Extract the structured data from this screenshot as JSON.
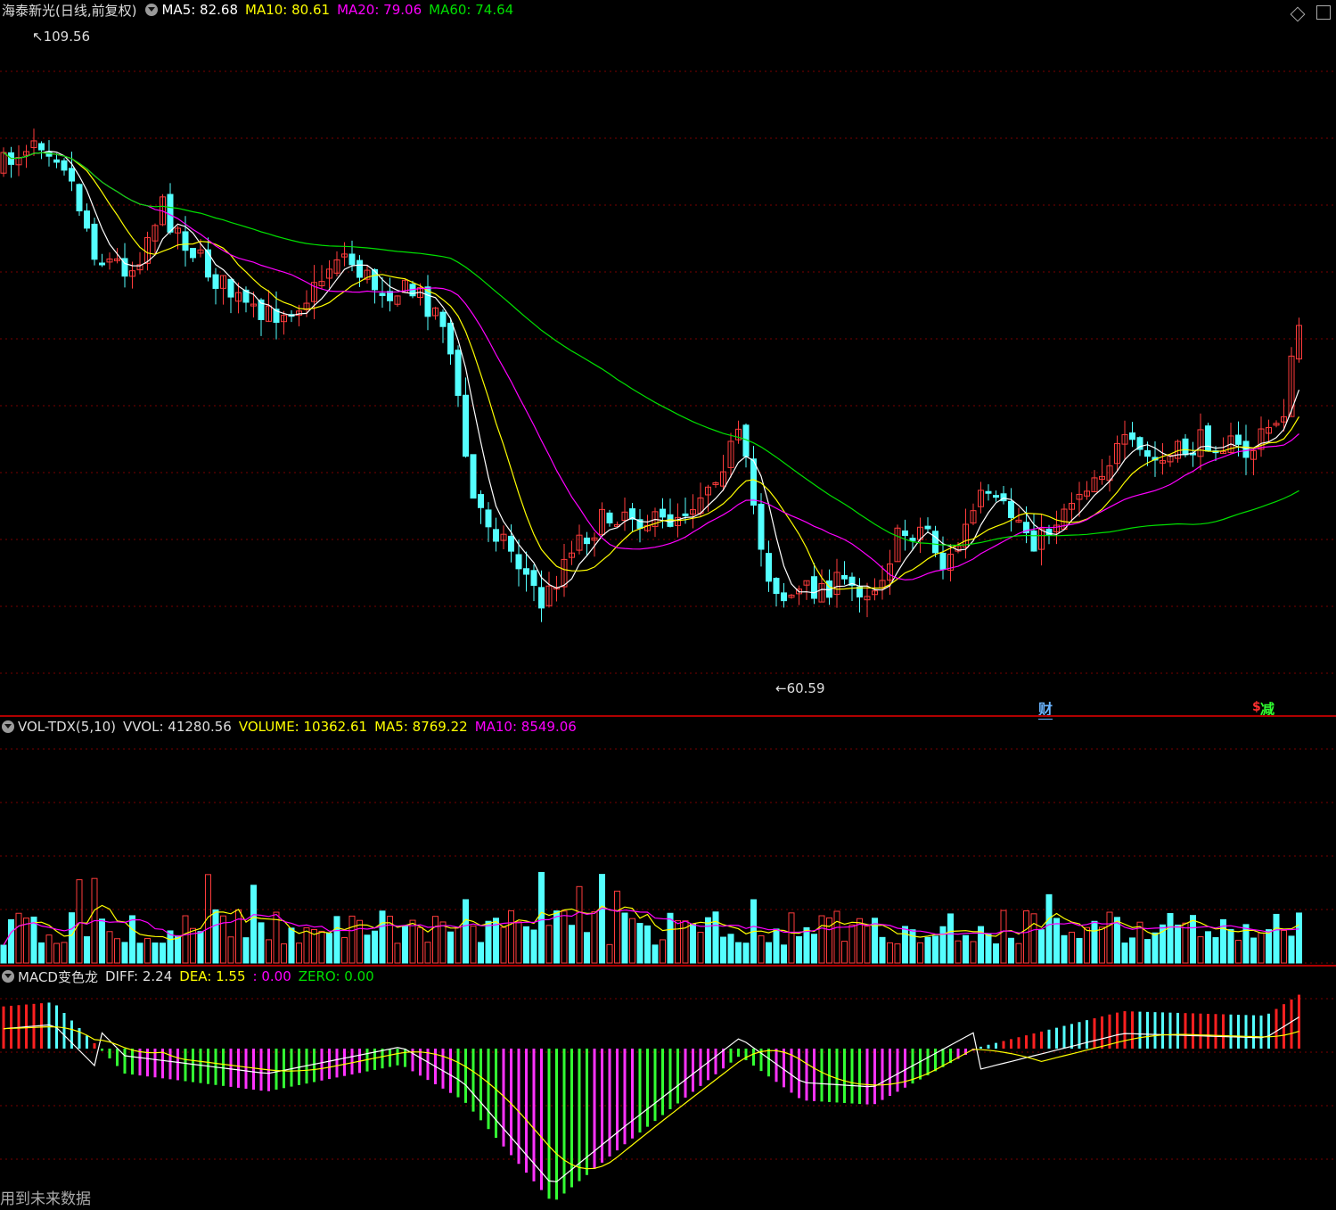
{
  "price_panel": {
    "name": "海泰新光(日线,前复权)",
    "ma5": "MA5: 82.68",
    "ma10": "MA10: 80.61",
    "ma20": "MA20: 79.06",
    "ma60": "MA60: 74.64",
    "high_label": "109.56",
    "low_label": "60.59",
    "marker_cai": "财",
    "marker_jian": "减",
    "marker_s": "$"
  },
  "volume_panel": {
    "name": "VOL-TDX(5,10)",
    "vvol": "VVOL: 41280.56",
    "volume": "VOLUME: 10362.61",
    "ma5": "MA5: 8769.22",
    "ma10": "MA10: 8549.06"
  },
  "macd_panel": {
    "name": "MACD变色龙",
    "diff": "DIFF: 2.24",
    "dea": "DEA: 1.55",
    "blank": ": 0.00",
    "zero": "ZERO: 0.00"
  },
  "footer": "用到未来数据",
  "colors": {
    "up": "#ff3c3c",
    "down": "#54ffff",
    "ma5": "#ffffff",
    "ma10": "#ffff00",
    "ma20": "#ff00ff",
    "ma60": "#00e000",
    "grid": "#7a0000",
    "macd_pos_a": "#ff2020",
    "macd_pos_b": "#54ffff",
    "macd_neg_a": "#33ff33",
    "macd_neg_b": "#ff33ff"
  },
  "chart_data": {
    "type": "candlestick",
    "extremes": {
      "high": 109.56,
      "low": 60.59
    },
    "ma_last": {
      "ma5": 82.68,
      "ma10": 80.61,
      "ma20": 79.06,
      "ma60": 74.64
    },
    "volume_last": {
      "vvol": 41280.56,
      "volume": 10362.61,
      "ma5": 8769.22,
      "ma10": 8549.06
    },
    "macd_last": {
      "diff": 2.24,
      "dea": 1.55,
      "zero": 0.0
    }
  }
}
